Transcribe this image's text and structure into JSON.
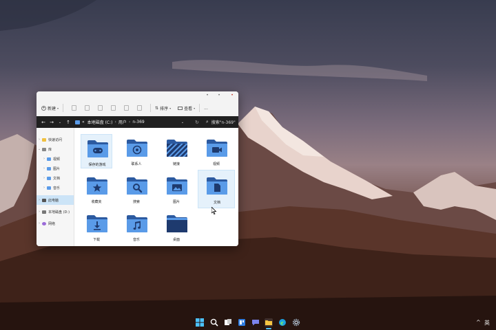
{
  "window": {
    "toolbar": {
      "new_label": "新建",
      "sort_label": "排序",
      "view_label": "查看",
      "more_label": "..."
    },
    "address": {
      "overflow": "«",
      "crumb1": "本地磁盘 (C:)",
      "crumb2": "用户",
      "crumb3": "n-369",
      "search_placeholder": "搜索\"n-369\""
    },
    "sidebar": {
      "items": [
        {
          "label": "快速访问"
        },
        {
          "label": "库"
        },
        {
          "label": "视频"
        },
        {
          "label": "图片"
        },
        {
          "label": "文档"
        },
        {
          "label": "音乐"
        },
        {
          "label": "此电脑"
        },
        {
          "label": "本地磁盘 (D:)"
        },
        {
          "label": "网络"
        }
      ]
    },
    "folders": [
      {
        "label": "保存的游戏",
        "icon": "gamepad-icon"
      },
      {
        "label": "联系人",
        "icon": "at-icon"
      },
      {
        "label": "链接",
        "icon": "stripes-icon"
      },
      {
        "label": "视频",
        "icon": "camera-icon"
      },
      {
        "label": "收藏夹",
        "icon": "star-icon"
      },
      {
        "label": "搜索",
        "icon": "magnifier-icon"
      },
      {
        "label": "图片",
        "icon": "image-icon"
      },
      {
        "label": "文档",
        "icon": "document-icon"
      },
      {
        "label": "下载",
        "icon": "download-icon"
      },
      {
        "label": "音乐",
        "icon": "music-icon"
      },
      {
        "label": "桌面",
        "icon": "desktop-icon"
      }
    ]
  },
  "taskbar": {
    "tray_chevron": "^",
    "ime_label": "英"
  },
  "colors": {
    "folder_blue": "#5a9be8",
    "folder_dark": "#2c5aa0",
    "selection": "#e5f1fb",
    "addressbar": "#202020"
  }
}
